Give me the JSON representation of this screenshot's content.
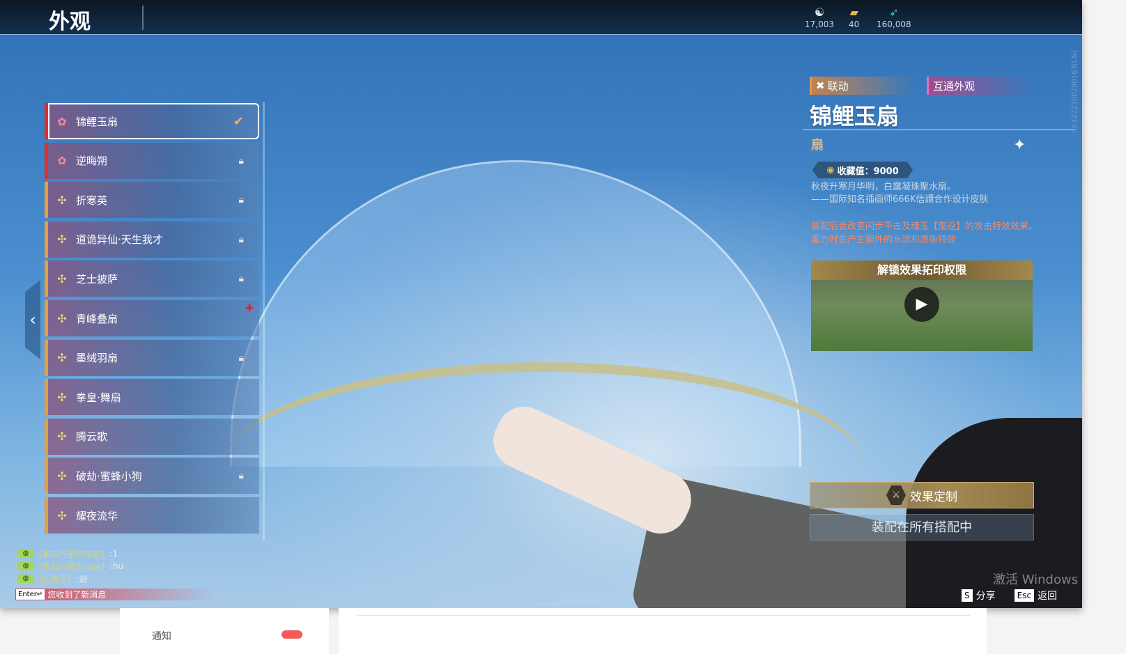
{
  "header": {
    "title": "外观",
    "currencies": [
      {
        "icon": "spirit-coin-icon",
        "value": "17,003"
      },
      {
        "icon": "gold-ticket-icon",
        "value": "40"
      },
      {
        "icon": "jade-feather-icon",
        "value": "160,008"
      }
    ]
  },
  "list": {
    "items": [
      {
        "label": "锦鲤玉扇",
        "rarity": "red",
        "status": "equipped"
      },
      {
        "label": "逆晦朔",
        "rarity": "red",
        "status": "locked"
      },
      {
        "label": "折寒英",
        "rarity": "gold",
        "status": "locked"
      },
      {
        "label": "道诡异仙·天生我才",
        "rarity": "gold",
        "status": "locked"
      },
      {
        "label": "芝士披萨",
        "rarity": "gold",
        "status": "locked"
      },
      {
        "label": "青峰叠扇",
        "rarity": "gold",
        "status": "new"
      },
      {
        "label": "墨绒羽扇",
        "rarity": "gold",
        "status": "locked"
      },
      {
        "label": "拳皇·舞扇",
        "rarity": "gold",
        "status": ""
      },
      {
        "label": "腾云歌",
        "rarity": "gold",
        "status": ""
      },
      {
        "label": "破劫·蜜蜂小狗",
        "rarity": "gold",
        "status": "locked"
      },
      {
        "label": "耀夜流华",
        "rarity": "gold",
        "status": ""
      }
    ]
  },
  "chat": {
    "messages": [
      {
        "name": "[第四行星的奇迹]",
        "text": ":1"
      },
      {
        "name": "[魚丸与猫Snake]",
        "text": ":hu"
      },
      {
        "name": "[认寒雪]",
        "text": ":胡"
      }
    ],
    "enter_key": "Enter↵",
    "notice": "您收到了新消息"
  },
  "detail": {
    "tag_collab": "联动",
    "tag_shared": "互通外观",
    "name": "锦鲤玉扇",
    "type": "扇",
    "collect": "收藏值：9000",
    "desc_lines": [
      "秋夜升寒月华明，白露凝珠聚水扇。",
      "——国际知名插画师666K信譞合作设计皮肤"
    ],
    "effect_lines": [
      "装配后会改变闪步平击及魂玉【鬼返】的攻击特效效果。",
      "蓄力时会产生额外的水流和游鱼特效"
    ],
    "video_title": "解锁效果拓印权限",
    "customize_label": "效果定制",
    "equip_all_label": "装配在所有搭配中"
  },
  "hotkeys": {
    "share_key": "S",
    "share_label": "分享",
    "back_key": "Esc",
    "back_label": "返回"
  },
  "watermark": "激活 Windows",
  "id_text": "ID:1222300290163[CN]",
  "web": {
    "notice_label": "通知"
  }
}
